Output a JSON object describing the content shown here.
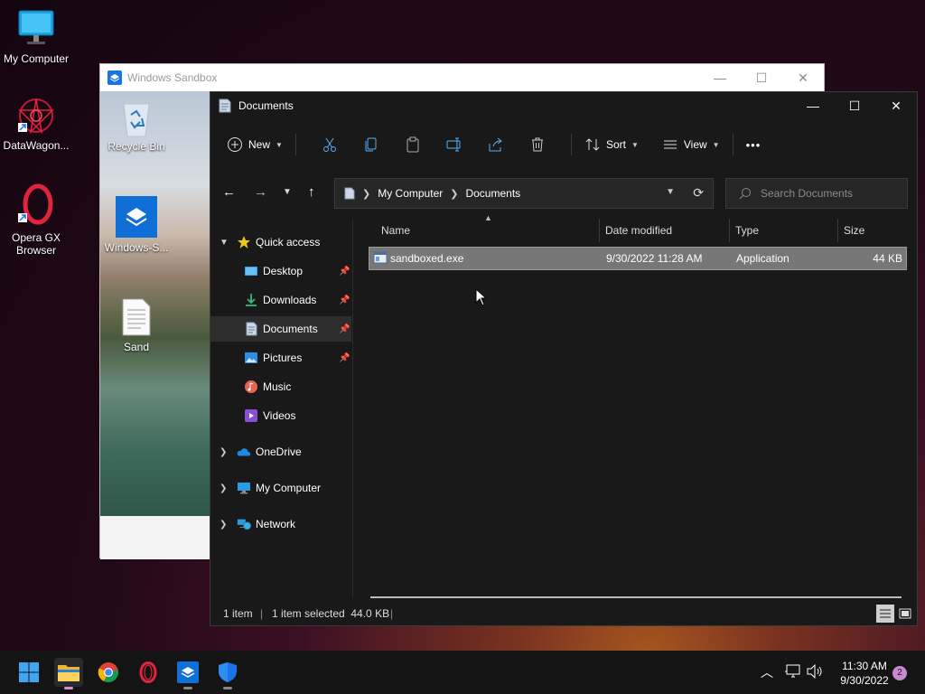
{
  "desktop": {
    "icons": [
      {
        "label": "My Computer",
        "icon": "monitor-icon"
      },
      {
        "label": "DataWagon...",
        "icon": "datawagon-icon"
      },
      {
        "label": "Opera GX Browser",
        "icon": "opera-gx-icon"
      }
    ]
  },
  "sandbox": {
    "title": "Windows Sandbox",
    "controls": {
      "minimize": "—",
      "maximize": "☐",
      "close": "✕"
    },
    "icons": [
      {
        "label": "Recycle Bin",
        "icon": "recycle-bin-icon"
      },
      {
        "label": "Windows-S...",
        "icon": "windows-sandbox-icon"
      },
      {
        "label": "Sand",
        "icon": "text-file-icon"
      }
    ]
  },
  "explorer": {
    "title": "Documents",
    "controls": {
      "minimize": "—",
      "maximize": "☐",
      "close": "✕"
    },
    "toolbar": {
      "new_label": "New",
      "sort_label": "Sort",
      "view_label": "View",
      "more_label": "•••"
    },
    "address": {
      "segments": [
        "My Computer",
        "Documents"
      ],
      "search_placeholder": "Search Documents"
    },
    "sidebar": {
      "quick_access": "Quick access",
      "items": [
        {
          "label": "Desktop",
          "pinned": true
        },
        {
          "label": "Downloads",
          "pinned": true
        },
        {
          "label": "Documents",
          "pinned": true,
          "selected": true
        },
        {
          "label": "Pictures",
          "pinned": true
        },
        {
          "label": "Music",
          "pinned": false
        },
        {
          "label": "Videos",
          "pinned": false
        }
      ],
      "onedrive": "OneDrive",
      "my_computer": "My Computer",
      "network": "Network"
    },
    "columns": {
      "name": "Name",
      "date": "Date modified",
      "type": "Type",
      "size": "Size"
    },
    "files": [
      {
        "name": "sandboxed.exe",
        "date": "9/30/2022 11:28 AM",
        "type": "Application",
        "size": "44 KB"
      }
    ],
    "status": {
      "items": "1 item",
      "selected": "1 item selected  44.0 KB"
    }
  },
  "taskbar": {
    "time": "11:30 AM",
    "date": "9/30/2022",
    "notification_count": "2",
    "apps": [
      "windows-start-icon",
      "file-explorer-icon",
      "chrome-icon",
      "opera-gx-icon",
      "windows-sandbox-icon",
      "windows-security-icon"
    ]
  },
  "colors": {
    "accent": "#0078d4",
    "explorer_bg": "#191919",
    "selection": "#777777"
  }
}
